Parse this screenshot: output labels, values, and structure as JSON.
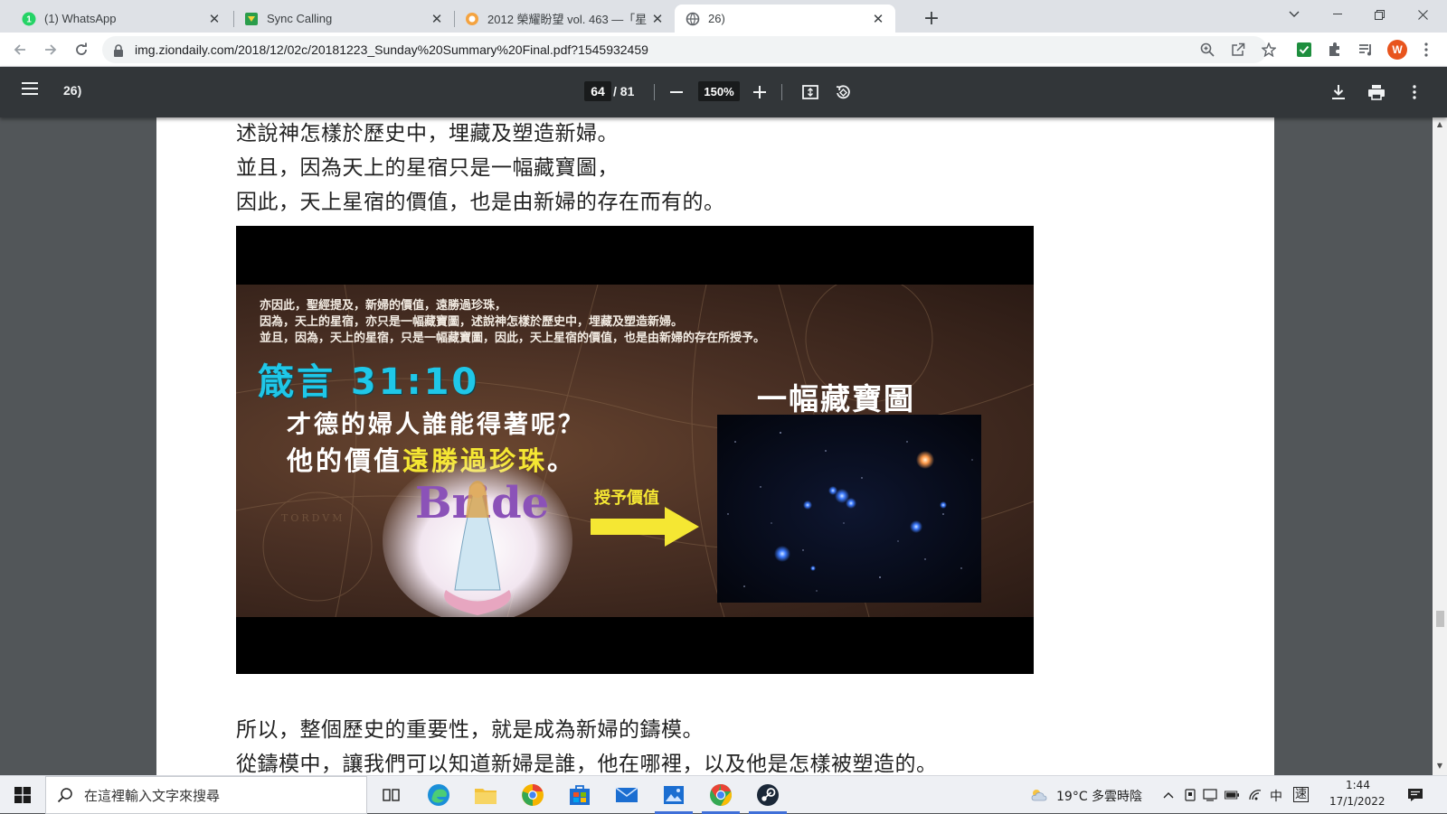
{
  "browser": {
    "tabs": [
      {
        "title": "(1) WhatsApp",
        "icon": "whatsapp-icon"
      },
      {
        "title": "Sync Calling",
        "icon": "sync-calling-icon"
      },
      {
        "title": "2012 榮耀盼望 vol. 463 —「星",
        "icon": "zion-daily-icon"
      },
      {
        "title": "26)",
        "icon": "globe-icon",
        "active": true
      }
    ],
    "url": "img.ziondaily.com/2018/12/02c/20181223_Sunday%20Summary%20Final.pdf?1545932459",
    "profile_initial": "W"
  },
  "pdf_toolbar": {
    "doc_title": "26)",
    "current_page": "64",
    "total_pages": "/ 81",
    "zoom": "150%"
  },
  "document": {
    "lines_top": [
      "述說神怎樣於歷史中，埋藏及塑造新婦。",
      "並且，因為天上的星宿只是一幅藏寶圖，",
      "因此，天上星宿的價值，也是由新婦的存在而有的。"
    ],
    "slide": {
      "small_lines": [
        "亦因此，聖經提及，新婦的價值，遠勝過珍珠，",
        "因為，天上的星宿，亦只是一幅藏寶圖，述說神怎樣於歷史中，埋藏及塑造新婦。",
        "並且，因為，天上的星宿，只是一幅藏寶圖，因此，天上星宿的價值，也是由新婦的存在所授予。"
      ],
      "verse": "箴言 31:10",
      "question_1": "才德的婦人誰能得著呢？",
      "question_2_prefix": "他的價值",
      "question_2_highlight": "遠勝過珍珠",
      "question_2_suffix": "。",
      "treasure_title": "一幅藏寶圖",
      "give_label": "授予價值",
      "bride_word": "Bride"
    },
    "lines_bottom": [
      "所以，整個歷史的重要性，就是成為新婦的鑄模。",
      "從鑄模中，讓我們可以知道新婦是誰，他在哪裡，以及他是怎樣被塑造的。"
    ]
  },
  "taskbar": {
    "search_placeholder": "在這裡輸入文字來搜尋",
    "weather": "19°C  多雲時陰",
    "ime_lang": "中",
    "ime_mode": "速",
    "time": "1:44",
    "date": "17/1/2022"
  },
  "colors": {
    "accent_cyan": "#1fc7e8",
    "accent_yellow": "#f5e733",
    "pdf_toolbar": "#323639",
    "viewer_bg": "#525659"
  }
}
